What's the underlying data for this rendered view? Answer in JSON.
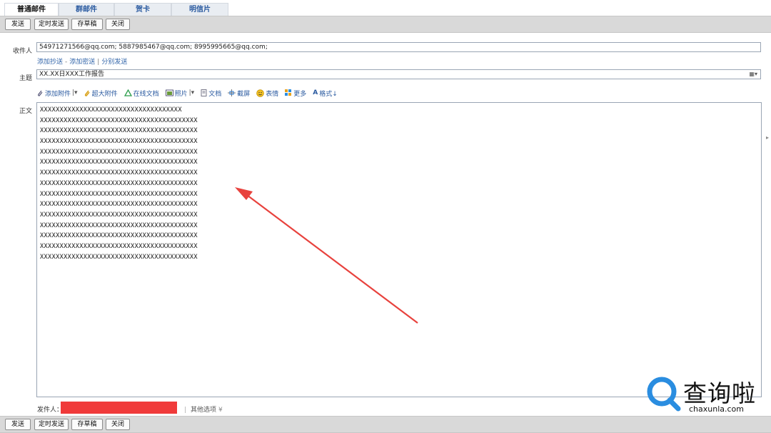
{
  "tabs": [
    {
      "label": "普通邮件",
      "active": true
    },
    {
      "label": "群邮件",
      "active": false
    },
    {
      "label": "贺卡",
      "active": false
    },
    {
      "label": "明信片",
      "active": false
    }
  ],
  "toolbar": {
    "send": "发送",
    "scheduled": "定时发送",
    "draft": "存草稿",
    "close": "关闭"
  },
  "recipient": {
    "label": "收件人",
    "value": "54971271566@qq.com; 5887985467@qq.com; 8995995665@qq.com;",
    "add_cc": "添加抄送",
    "add_bcc": "添加密送",
    "separate": "分别发送",
    "dash": "-",
    "pipe": "|"
  },
  "subject": {
    "label": "主题",
    "value": "XX.XX日XXX工作报告"
  },
  "format_toolbar": {
    "add_attachment": "添加附件",
    "large_attachment": "超大附件",
    "online_doc": "在线文档",
    "photo": "照片",
    "document": "文档",
    "screenshot": "截屏",
    "emoji": "表情",
    "more": "更多",
    "format": "格式↓"
  },
  "body": {
    "label": "正文",
    "lines": [
      "XXXXXXXXXXXXXXXXXXXXXXXXXXXXXXXXXXXX",
      "XXXXXXXXXXXXXXXXXXXXXXXXXXXXXXXXXXXXXXXX",
      "XXXXXXXXXXXXXXXXXXXXXXXXXXXXXXXXXXXXXXXX",
      "XXXXXXXXXXXXXXXXXXXXXXXXXXXXXXXXXXXXXXXX",
      "XXXXXXXXXXXXXXXXXXXXXXXXXXXXXXXXXXXXXXXX",
      "XXXXXXXXXXXXXXXXXXXXXXXXXXXXXXXXXXXXXXXX",
      "XXXXXXXXXXXXXXXXXXXXXXXXXXXXXXXXXXXXXXXX",
      "XXXXXXXXXXXXXXXXXXXXXXXXXXXXXXXXXXXXXXXX",
      "XXXXXXXXXXXXXXXXXXXXXXXXXXXXXXXXXXXXXXXX",
      "XXXXXXXXXXXXXXXXXXXXXXXXXXXXXXXXXXXXXXXX",
      "XXXXXXXXXXXXXXXXXXXXXXXXXXXXXXXXXXXXXXXX",
      "XXXXXXXXXXXXXXXXXXXXXXXXXXXXXXXXXXXXXXXX",
      "XXXXXXXXXXXXXXXXXXXXXXXXXXXXXXXXXXXXXXXX",
      "XXXXXXXXXXXXXXXXXXXXXXXXXXXXXXXXXXXXXXXX",
      "XXXXXXXXXXXXXXXXXXXXXXXXXXXXXXXXXXXXXXXX"
    ]
  },
  "sender": {
    "label": "发件人：",
    "other_options": "其他选项",
    "pipe": "|"
  },
  "annotation": {
    "arrow_color": "#e8423d"
  },
  "watermark": {
    "brand": "查询啦",
    "url": "chaxunla.com",
    "logo_color": "#2a8de0"
  },
  "colors": {
    "link": "#3366aa",
    "toolbar_bg": "#d9d9d9",
    "redaction": "#f03a3a"
  }
}
